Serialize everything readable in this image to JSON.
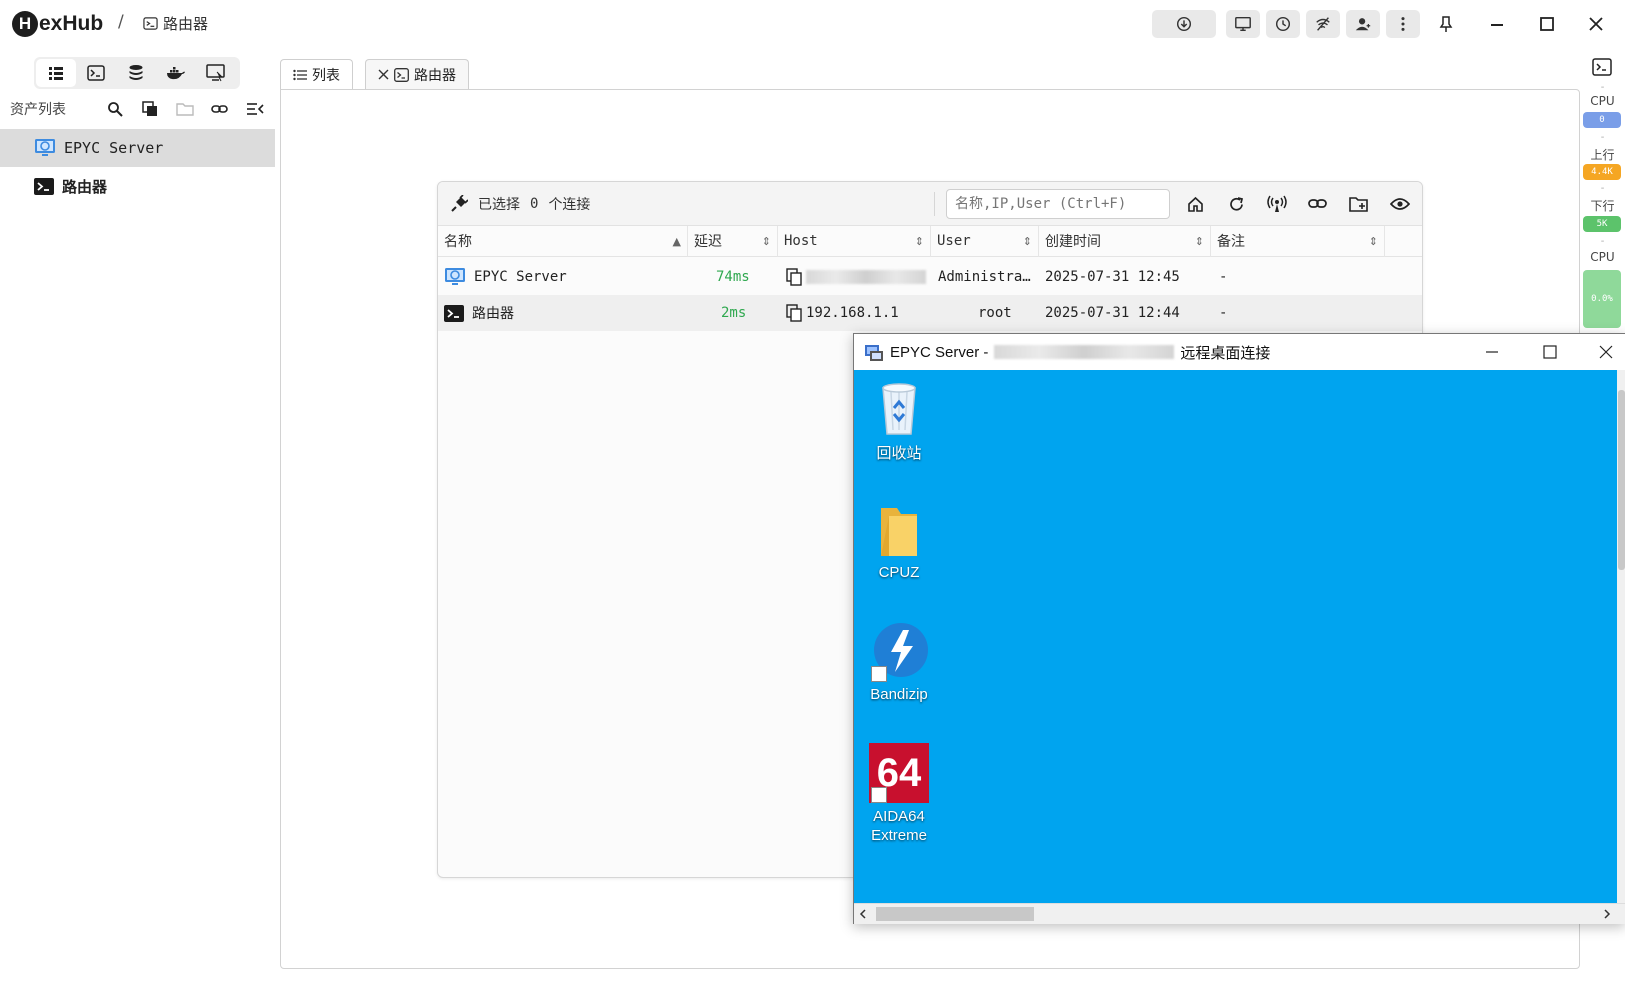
{
  "app": {
    "name": "exHub",
    "logo_letter": "H",
    "breadcrumb_sep": "/",
    "breadcrumb": "路由器"
  },
  "sidebar": {
    "title": "资产列表",
    "items": [
      {
        "label": "EPYC Server",
        "icon": "remote-desktop-icon",
        "selected": true
      },
      {
        "label": "路由器",
        "icon": "terminal-icon",
        "selected": false
      }
    ]
  },
  "tabs": [
    {
      "label": "列表",
      "icon": "list-icon"
    },
    {
      "label": "路由器",
      "icon": "terminal-icon",
      "closable": true
    }
  ],
  "list": {
    "selection_text": "已选择",
    "selection_count": "0",
    "selection_unit": "个连接",
    "search_placeholder": "名称,IP,User (Ctrl+F)",
    "columns": [
      "名称",
      "延迟",
      "Host",
      "User",
      "创建时间",
      "备注"
    ],
    "rows": [
      {
        "name": "EPYC Server",
        "latency": "74ms",
        "host": "",
        "user": "Administra…",
        "created": "2025-07-31 12:45",
        "note": "-"
      },
      {
        "name": "路由器",
        "latency": "2ms",
        "host": "192.168.1.1",
        "user": "root",
        "created": "2025-07-31 12:44",
        "note": "-"
      }
    ]
  },
  "rail": {
    "dash": "-",
    "cpu_label": "CPU",
    "cpu_value": "0",
    "up_label": "上行",
    "up_value": "4.4K",
    "down_label": "下行",
    "down_value": "5K",
    "cpu2_label": "CPU",
    "cpu2_value": "0.0%"
  },
  "rdp": {
    "title_prefix": "EPYC Server -",
    "title_suffix": "远程桌面连接",
    "desktop_icons": [
      {
        "label": "回收站"
      },
      {
        "label": "CPUZ"
      },
      {
        "label": "Bandizip"
      },
      {
        "label": "AIDA64 Extreme",
        "logo_text": "64"
      }
    ]
  },
  "colors": {
    "accent_green": "#2fa84f",
    "desktop_blue": "#00a4ef",
    "rail_blue": "#7a9ee8",
    "rail_orange": "#f5a623",
    "rail_green": "#5cc36b"
  }
}
